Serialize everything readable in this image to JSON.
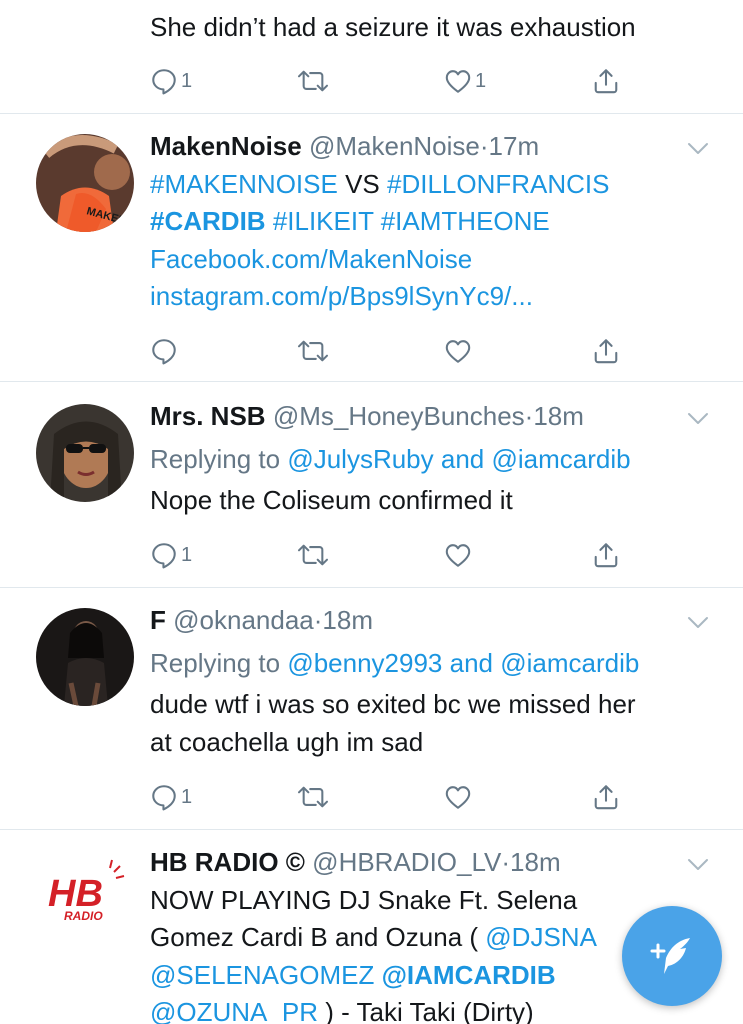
{
  "tweets": [
    {
      "text": "She didn’t had a seizure it was exhaustion",
      "reply_count": "1",
      "like_count": "1"
    },
    {
      "name": "MakenNoise",
      "handle": "@MakenNoise",
      "time": "17m",
      "tags1": [
        "#MAKENNOISE",
        "VS",
        "#DILLONFRANCIS"
      ],
      "tags2_bold": "#CARDIB",
      "tags2_rest": "#ILIKEIT #IAMTHEONE",
      "link1": "Facebook.com/MakenNoise",
      "link2": "instagram.com/p/Bps9lSynYc9/..."
    },
    {
      "name": "Mrs. NSB",
      "handle": "@Ms_HoneyBunches",
      "time": "18m",
      "replying_prefix": "Replying to",
      "replying_user1": "@JulysRuby",
      "replying_and": "and",
      "replying_user2": "@iamcardib",
      "text": "Nope the Coliseum confirmed it",
      "reply_count": "1"
    },
    {
      "name": "F",
      "handle": "@oknandaa",
      "time": "18m",
      "replying_prefix": "Replying to",
      "replying_user1": "@benny2993",
      "replying_and": "and",
      "replying_user2": "@iamcardib",
      "text1": "dude wtf i was so exited bc we missed her",
      "text2": "at coachella ugh im sad",
      "reply_count": "1"
    },
    {
      "name": "HB RADIO ©",
      "handle": "@HBRADIO_LV",
      "time": "18m",
      "text1": "NOW PLAYING DJ Snake Ft. Selena",
      "text2a": "Gomez Cardi B and Ozuna (",
      "text2b": "@DJSNA",
      "mention1": "@SELENAGOMEZ",
      "mention2": "@IAMCARDIB",
      "mention3": "@OZUNA_PR",
      "text4": ") - Taki Taki (Dirty)",
      "logo_text": "HB",
      "logo_sub": "RADIO"
    }
  ],
  "separator": "·",
  "colors": {
    "link": "#1b95e0",
    "muted": "#657786",
    "fab": "#4aa3e8"
  },
  "icons": [
    "reply-icon",
    "retweet-icon",
    "like-icon",
    "share-icon",
    "chevron-down-icon",
    "compose-icon"
  ]
}
